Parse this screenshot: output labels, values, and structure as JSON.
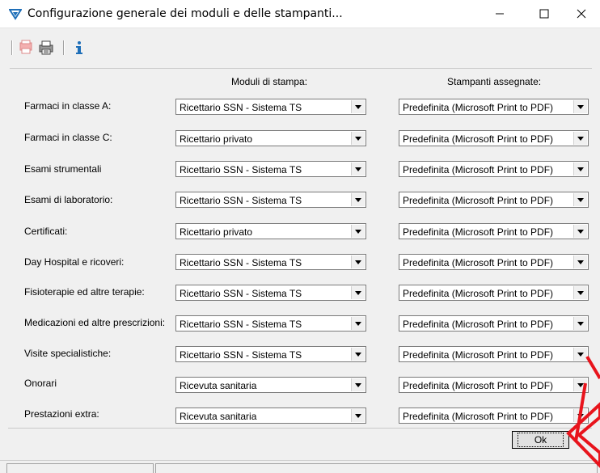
{
  "window": {
    "title": "Configurazione generale dei moduli e delle stampanti..."
  },
  "headers": {
    "modules": "Moduli di stampa:",
    "printers": "Stampanti assegnate:"
  },
  "rows": [
    {
      "label": "Farmaci in classe A:",
      "module": "Ricettario SSN - Sistema TS",
      "printer": "Predefinita (Microsoft Print to PDF)"
    },
    {
      "label": "Farmaci in classe C:",
      "module": "Ricettario privato",
      "printer": "Predefinita (Microsoft Print to PDF)"
    },
    {
      "label": "Esami strumentali",
      "module": "Ricettario SSN - Sistema TS",
      "printer": "Predefinita (Microsoft Print to PDF)"
    },
    {
      "label": "Esami di laboratorio:",
      "module": "Ricettario SSN - Sistema TS",
      "printer": "Predefinita (Microsoft Print to PDF)"
    },
    {
      "label": "Certificati:",
      "module": "Ricettario privato",
      "printer": "Predefinita (Microsoft Print to PDF)"
    },
    {
      "label": "Day Hospital e ricoveri:",
      "module": "Ricettario SSN - Sistema TS",
      "printer": "Predefinita (Microsoft Print to PDF)"
    },
    {
      "label": "Fisioterapie ed altre terapie:",
      "module": "Ricettario SSN - Sistema TS",
      "printer": "Predefinita (Microsoft Print to PDF)"
    },
    {
      "label": "Medicazioni ed altre prescrizioni:",
      "module": "Ricettario SSN - Sistema TS",
      "printer": "Predefinita (Microsoft Print to PDF)"
    },
    {
      "label": "Visite specialistiche:",
      "module": "Ricettario SSN - Sistema TS",
      "printer": "Predefinita (Microsoft Print to PDF)"
    },
    {
      "label": "Onorari",
      "module": "Ricevuta sanitaria",
      "printer": "Predefinita (Microsoft Print to PDF)"
    },
    {
      "label": "Prestazioni extra:",
      "module": "Ricevuta sanitaria",
      "printer": "Predefinita (Microsoft Print to PDF)"
    }
  ],
  "ok_label": "Ok",
  "icons": {
    "app": "app-triangle-icon",
    "toolbar": [
      "printer-config-icon",
      "printer-icon",
      "info-icon"
    ]
  },
  "colors": {
    "accent_icon": "#1f6fb8",
    "annotation": "#e8141c"
  }
}
